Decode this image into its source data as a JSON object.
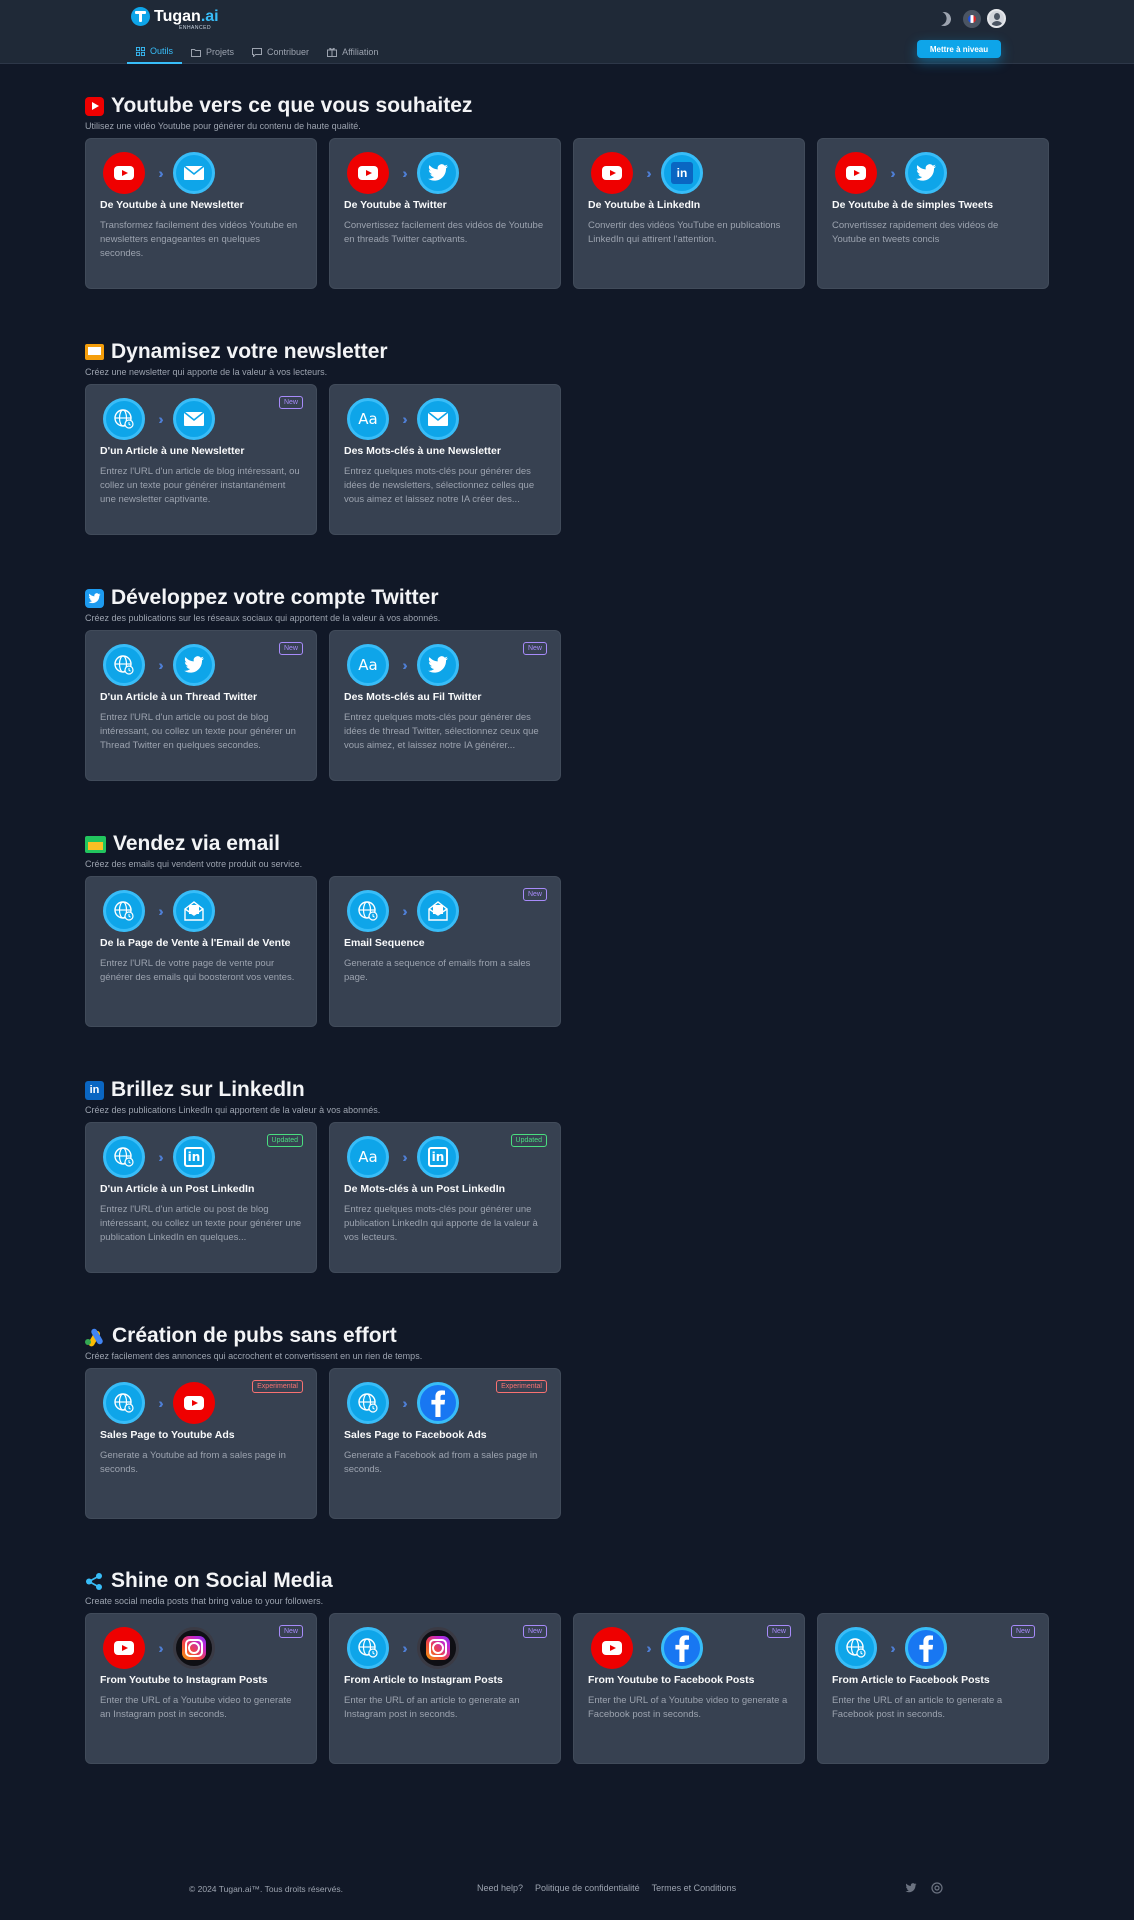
{
  "header": {
    "brand": "Tugan",
    "brand_suffix": ".ai",
    "brand_tag": "ENHANCED",
    "nav": [
      {
        "label": "Outils",
        "active": true
      },
      {
        "label": "Projets",
        "active": false
      },
      {
        "label": "Contribuer",
        "active": false
      },
      {
        "label": "Affiliation",
        "active": false
      }
    ],
    "upgrade_label": "Mettre à niveau"
  },
  "sections": [
    {
      "title": "Youtube vers ce que vous souhaitez",
      "subtitle": "Utilisez une vidéo Youtube pour générer du contenu de haute qualité.",
      "cards": [
        {
          "title": "De Youtube à une Newsletter",
          "desc": "Transformez facilement des vidéos Youtube en newsletters engageantes en quelques secondes.",
          "badge": ""
        },
        {
          "title": "De Youtube à Twitter",
          "desc": "Convertissez facilement des vidéos de Youtube en threads Twitter captivants.",
          "badge": ""
        },
        {
          "title": "De Youtube à LinkedIn",
          "desc": "Convertir des vidéos YouTube en publications LinkedIn qui attirent l'attention.",
          "badge": ""
        },
        {
          "title": "De Youtube à de simples Tweets",
          "desc": "Convertissez rapidement des vidéos de Youtube en tweets concis",
          "badge": ""
        }
      ]
    },
    {
      "title": "Dynamisez votre newsletter",
      "subtitle": "Créez une newsletter qui apporte de la valeur à vos lecteurs.",
      "cards": [
        {
          "title": "D'un Article à une Newsletter",
          "desc": "Entrez l'URL d'un article de blog intéressant, ou collez un texte pour générer instantanément une newsletter captivante.",
          "badge": "New"
        },
        {
          "title": "Des Mots-clés à une Newsletter",
          "desc": "Entrez quelques mots-clés pour générer des idées de newsletters, sélectionnez celles que vous aimez et laissez notre IA créer des...",
          "badge": ""
        }
      ]
    },
    {
      "title": "Développez votre compte Twitter",
      "subtitle": "Créez des publications sur les réseaux sociaux qui apportent de la valeur à vos abonnés.",
      "cards": [
        {
          "title": "D'un Article à un Thread Twitter",
          "desc": "Entrez l'URL d'un article ou post de blog intéressant, ou collez un texte pour générer un Thread Twitter en quelques secondes.",
          "badge": "New"
        },
        {
          "title": "Des Mots-clés au Fil Twitter",
          "desc": "Entrez quelques mots-clés pour générer des idées de thread Twitter, sélectionnez ceux que vous aimez, et laissez notre IA générer...",
          "badge": "New"
        }
      ]
    },
    {
      "title": "Vendez via email",
      "subtitle": "Créez des emails qui vendent votre produit ou service.",
      "cards": [
        {
          "title": "De la Page de Vente à l'Email de Vente",
          "desc": "Entrez l'URL de votre page de vente pour générer des emails qui boosteront vos ventes.",
          "badge": ""
        },
        {
          "title": "Email Sequence",
          "desc": "Generate a sequence of emails from a sales page.",
          "badge": "New"
        }
      ]
    },
    {
      "title": "Brillez sur LinkedIn",
      "subtitle": "Créez des publications LinkedIn qui apportent de la valeur à vos abonnés.",
      "cards": [
        {
          "title": "D'un Article à un Post LinkedIn",
          "desc": "Entrez l'URL d'un article ou post de blog intéressant, ou collez un texte pour générer une publication LinkedIn en quelques...",
          "badge": "Updated"
        },
        {
          "title": "De Mots-clés à un Post LinkedIn",
          "desc": "Entrez quelques mots-clés pour générer une publication LinkedIn qui apporte de la valeur à vos lecteurs.",
          "badge": "Updated"
        }
      ]
    },
    {
      "title": "Création de pubs sans effort",
      "subtitle": "Créez facilement des annonces qui accrochent et convertissent en un rien de temps.",
      "cards": [
        {
          "title": "Sales Page to Youtube Ads",
          "desc": "Generate a Youtube ad from a sales page in seconds.",
          "badge": "Experimental"
        },
        {
          "title": "Sales Page to Facebook Ads",
          "desc": "Generate a Facebook ad from a sales page in seconds.",
          "badge": "Experimental"
        }
      ]
    },
    {
      "title": "Shine on Social Media",
      "subtitle": "Create social media posts that bring value to your followers.",
      "cards": [
        {
          "title": "From Youtube to Instagram Posts",
          "desc": "Enter the URL of a Youtube video to generate an Instagram post in seconds.",
          "badge": "New"
        },
        {
          "title": "From Article to Instagram Posts",
          "desc": "Enter the URL of an article to generate an Instagram post in seconds.",
          "badge": "New"
        },
        {
          "title": "From Youtube to Facebook Posts",
          "desc": "Enter the URL of a Youtube video to generate a Facebook post in seconds.",
          "badge": "New"
        },
        {
          "title": "From Article to Facebook Posts",
          "desc": "Enter the URL of an article to generate a Facebook post in seconds.",
          "badge": "New"
        }
      ]
    }
  ],
  "footer": {
    "copyright": "© 2024  Tugan.ai™. Tous droits réservés.",
    "links": [
      "Need help?",
      "Politique de confidentialité",
      "Termes et Conditions"
    ]
  },
  "icons": {
    "youtube": "youtube-icon",
    "twitter": "twitter-icon",
    "linkedin": "linkedin-icon",
    "email": "email-icon",
    "web": "globe-icon",
    "keywords": "text-aa-icon",
    "instagram": "instagram-icon",
    "facebook": "facebook-icon"
  },
  "colors": {
    "background": "#111827",
    "header": "#1f2937",
    "card": "#374151",
    "accent": "#0ea5e9",
    "youtube": "#ef0000"
  }
}
